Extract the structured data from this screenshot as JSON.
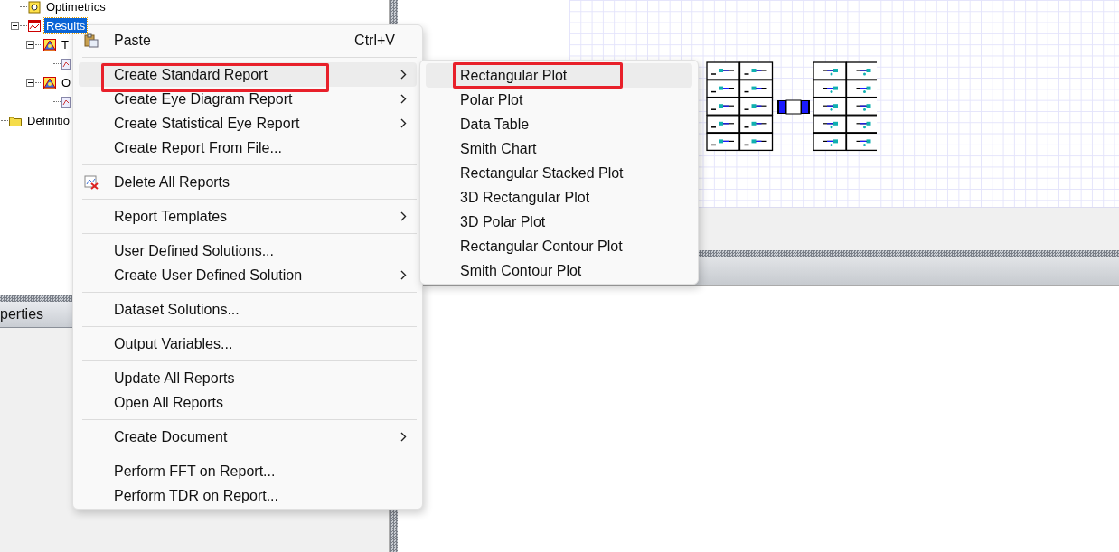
{
  "tree": {
    "nodes": [
      {
        "label": "Optimetrics",
        "kind": "optimetrics",
        "selected": false
      },
      {
        "label": "Results",
        "kind": "results",
        "selected": true,
        "expanded": true,
        "children": [
          {
            "label": "T",
            "kind": "report",
            "selected": false,
            "expanded": true,
            "children": [
              {
                "kind": "plot"
              }
            ]
          },
          {
            "label": "O",
            "kind": "report",
            "selected": false,
            "expanded": true,
            "children": [
              {
                "kind": "plot"
              }
            ]
          }
        ]
      }
    ],
    "outer_nodes": [
      {
        "label": "Definitio",
        "kind": "folder",
        "selected": false
      }
    ]
  },
  "properties_tab": {
    "label": "perties"
  },
  "context_menu": {
    "items": [
      {
        "kind": "paste",
        "label": "Paste",
        "shortcut": "Ctrl+V",
        "submenu": false,
        "highlighted": false,
        "annotated": false
      },
      {
        "kind": "separator"
      },
      {
        "kind": "item",
        "label": "Create Standard Report",
        "submenu": true,
        "highlighted": true,
        "annotated": true
      },
      {
        "kind": "item",
        "label": "Create Eye Diagram Report",
        "submenu": true,
        "highlighted": false,
        "annotated": false
      },
      {
        "kind": "item",
        "label": "Create Statistical Eye Report",
        "submenu": true,
        "highlighted": false,
        "annotated": false
      },
      {
        "kind": "item",
        "label": "Create Report From File...",
        "submenu": false,
        "highlighted": false,
        "annotated": false
      },
      {
        "kind": "separator"
      },
      {
        "kind": "delete",
        "label": "Delete All Reports",
        "submenu": false,
        "highlighted": false,
        "annotated": false
      },
      {
        "kind": "separator"
      },
      {
        "kind": "item",
        "label": "Report Templates",
        "submenu": true,
        "highlighted": false,
        "annotated": false
      },
      {
        "kind": "separator"
      },
      {
        "kind": "item",
        "label": "User Defined Solutions...",
        "submenu": false,
        "highlighted": false,
        "annotated": false
      },
      {
        "kind": "item",
        "label": "Create User Defined Solution",
        "submenu": true,
        "highlighted": false,
        "annotated": false
      },
      {
        "kind": "separator"
      },
      {
        "kind": "item",
        "label": "Dataset Solutions...",
        "submenu": false,
        "highlighted": false,
        "annotated": false
      },
      {
        "kind": "separator"
      },
      {
        "kind": "item",
        "label": "Output Variables...",
        "submenu": false,
        "highlighted": false,
        "annotated": false
      },
      {
        "kind": "separator"
      },
      {
        "kind": "item",
        "label": "Update All Reports",
        "submenu": false,
        "highlighted": false,
        "annotated": false
      },
      {
        "kind": "item",
        "label": "Open All Reports",
        "submenu": false,
        "highlighted": false,
        "annotated": false
      },
      {
        "kind": "separator"
      },
      {
        "kind": "item",
        "label": "Create Document",
        "submenu": true,
        "highlighted": false,
        "annotated": false
      },
      {
        "kind": "separator"
      },
      {
        "kind": "item",
        "label": "Perform FFT on Report...",
        "submenu": false,
        "highlighted": false,
        "annotated": false
      },
      {
        "kind": "item",
        "label": "Perform TDR on Report...",
        "submenu": false,
        "highlighted": false,
        "annotated": false
      }
    ]
  },
  "submenu": {
    "items": [
      {
        "label": "Rectangular Plot",
        "highlighted": true,
        "annotated": true
      },
      {
        "label": "Polar Plot",
        "highlighted": false,
        "annotated": false
      },
      {
        "label": "Data Table",
        "highlighted": false,
        "annotated": false
      },
      {
        "label": "Smith Chart",
        "highlighted": false,
        "annotated": false
      },
      {
        "label": "Rectangular Stacked Plot",
        "highlighted": false,
        "annotated": false
      },
      {
        "label": "3D Rectangular Plot",
        "highlighted": false,
        "annotated": false
      },
      {
        "label": "3D Polar Plot",
        "highlighted": false,
        "annotated": false
      },
      {
        "label": "Rectangular Contour Plot",
        "highlighted": false,
        "annotated": false
      },
      {
        "label": "Smith Contour Plot",
        "highlighted": false,
        "annotated": false
      }
    ]
  }
}
